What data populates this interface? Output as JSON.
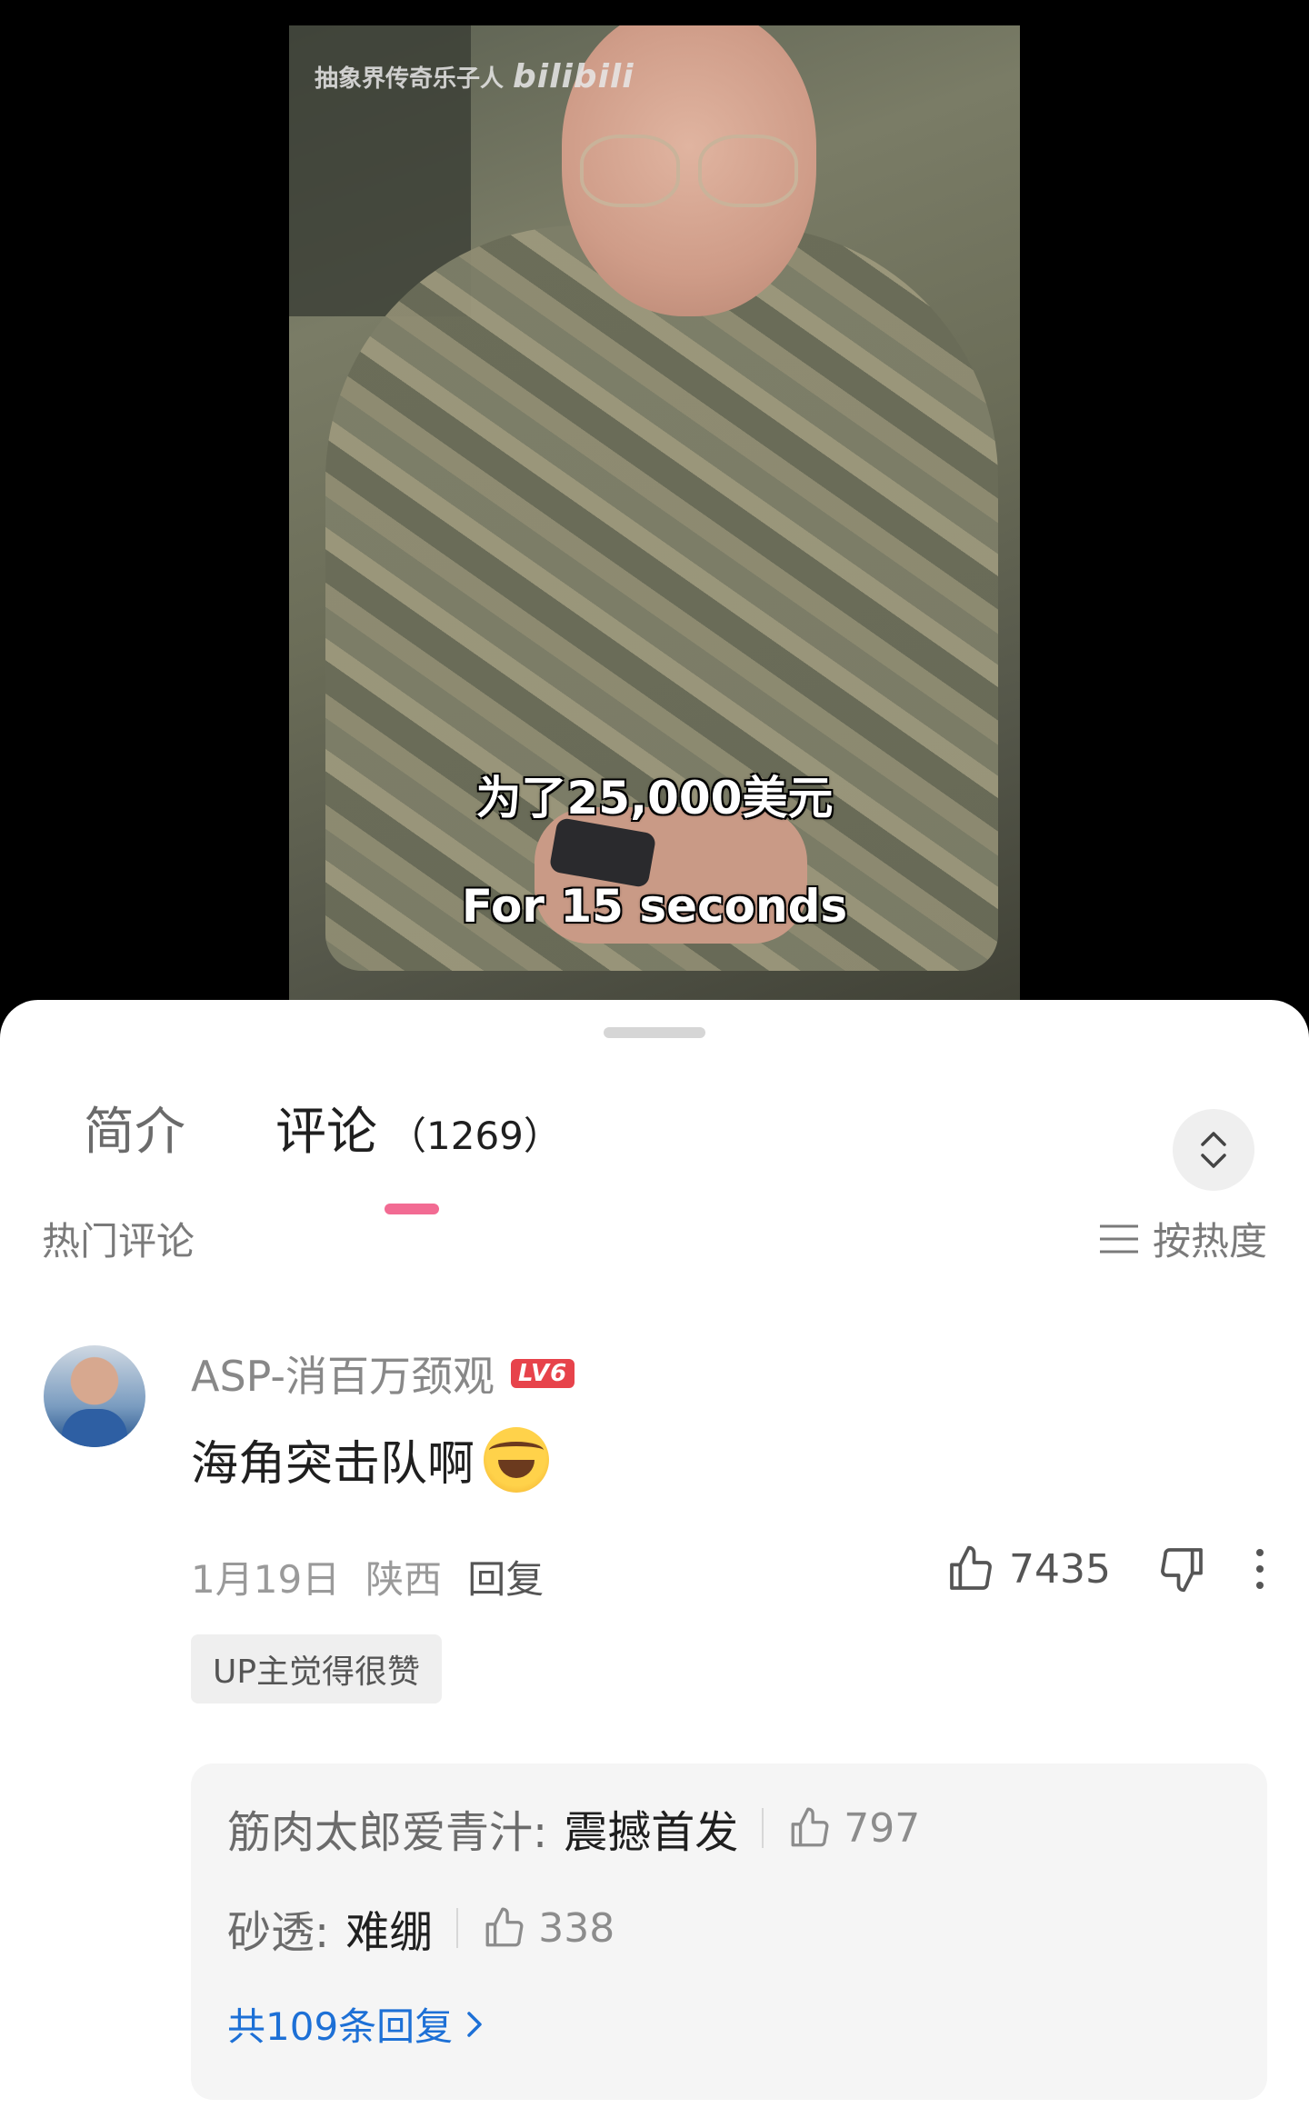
{
  "video": {
    "watermark_text": "抽象界传奇乐子人",
    "watermark_brand": "bilibili",
    "subtitle_cn": "为了25,000美元",
    "subtitle_en": "For 15 seconds"
  },
  "tabs": {
    "intro_label": "简介",
    "comments_label": "评论",
    "comments_count": "（1269）"
  },
  "sort": {
    "section_title": "热门评论",
    "sort_label": "按热度"
  },
  "comment": {
    "username": "ASP-消百万颈观",
    "level": "LV6",
    "text": "海角突击队啊",
    "date": "1月19日",
    "location": "陕西",
    "reply_label": "回复",
    "likes": "7435",
    "up_badge": "UP主觉得很赞"
  },
  "replies": {
    "items": [
      {
        "author": "筋肉太郎爱青汁:",
        "text": "震撼首发",
        "likes": "797"
      },
      {
        "author": "砂透:",
        "text": "难绷",
        "likes": "338"
      }
    ],
    "more_label": "共109条回复"
  },
  "colors": {
    "accent_pink": "#f26b93",
    "level_red": "#e7434b",
    "link_blue": "#1d70d6"
  }
}
